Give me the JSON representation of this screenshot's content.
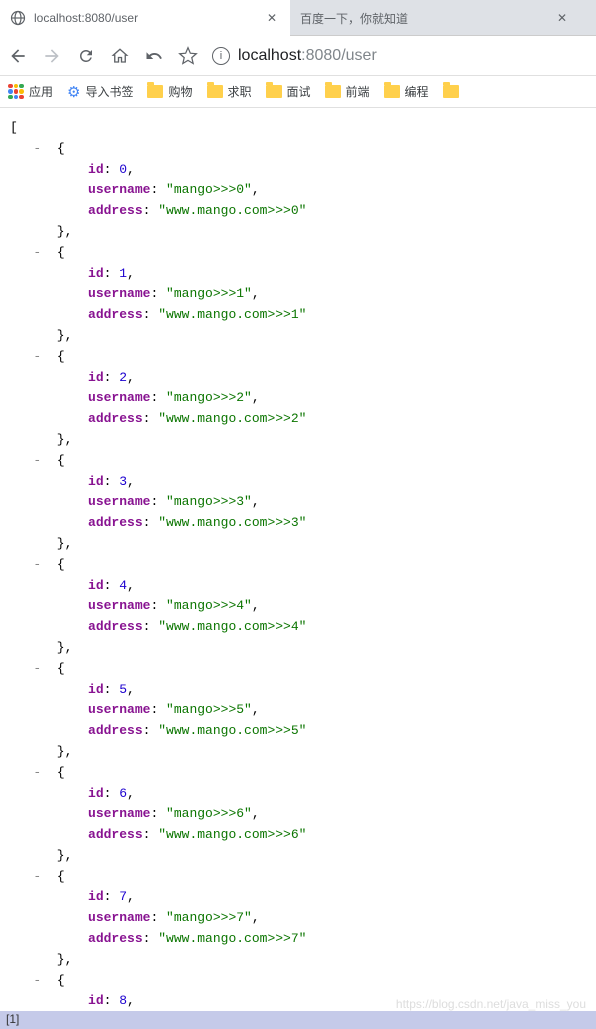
{
  "tabs": [
    {
      "title": "localhost:8080/user",
      "active": true
    },
    {
      "title": "百度一下，你就知道",
      "active": false
    }
  ],
  "url": {
    "host": "localhost",
    "port": ":8080",
    "path": "/user"
  },
  "bookmarks": {
    "apps": "应用",
    "import": "导入书签",
    "items": [
      "购物",
      "求职",
      "面试",
      "前端",
      "编程"
    ]
  },
  "json_entries": [
    {
      "id": 0,
      "username": "mango>>>0",
      "address": "www.mango.com>>>0"
    },
    {
      "id": 1,
      "username": "mango>>>1",
      "address": "www.mango.com>>>1"
    },
    {
      "id": 2,
      "username": "mango>>>2",
      "address": "www.mango.com>>>2"
    },
    {
      "id": 3,
      "username": "mango>>>3",
      "address": "www.mango.com>>>3"
    },
    {
      "id": 4,
      "username": "mango>>>4",
      "address": "www.mango.com>>>4"
    },
    {
      "id": 5,
      "username": "mango>>>5",
      "address": "www.mango.com>>>5"
    },
    {
      "id": 6,
      "username": "mango>>>6",
      "address": "www.mango.com>>>6"
    },
    {
      "id": 7,
      "username": "mango>>>7",
      "address": "www.mango.com>>>7"
    }
  ],
  "json_last_id": 8,
  "watermark": "https://blog.csdn.net/java_miss_you",
  "footer": "[1]"
}
